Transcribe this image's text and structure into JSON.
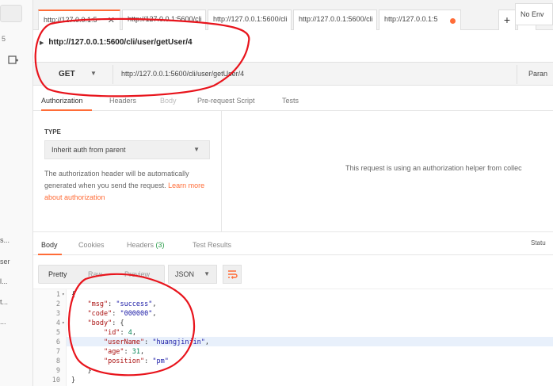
{
  "sidebar": {
    "count": "5",
    "items": [
      "s...",
      "ser",
      "l...",
      "t...",
      "..."
    ]
  },
  "tabs": [
    {
      "label": "http://127.0.0.1:5",
      "close": "✕"
    },
    {
      "label": "http://127.0.0.1:5600/cli"
    },
    {
      "label": "http://127.0.0.1:5600/cli"
    },
    {
      "label": "http://127.0.0.1:5600/cli"
    },
    {
      "label": "http://127.0.0.1:5"
    }
  ],
  "tab_add": "+",
  "tab_more": "•••",
  "environment": "No Env",
  "request": {
    "name": "http://127.0.0.1:5600/cli/user/getUser/4",
    "method": "GET",
    "url": "http://127.0.0.1:5600/cli/user/getUser/4",
    "params_label": "Paran"
  },
  "request_tabs": [
    "Authorization",
    "Headers",
    "Body",
    "Pre-request Script",
    "Tests"
  ],
  "auth": {
    "type_label": "TYPE",
    "type_value": "Inherit auth from parent",
    "description": "The authorization header will be automatically generated when you send the request.",
    "learn_more": "Learn more about authorization",
    "helper_text": "This request is using an authorization helper from collec"
  },
  "response_tabs": {
    "body": "Body",
    "cookies": "Cookies",
    "headers": "Headers",
    "headers_count": "(3)",
    "test_results": "Test Results"
  },
  "status_label": "Statu",
  "format": {
    "pretty": "Pretty",
    "raw": "Raw",
    "preview": "Preview",
    "type": "JSON"
  },
  "code_lines": [
    {
      "n": "1",
      "fold": "▾",
      "html_key": "l1"
    },
    {
      "n": "2"
    },
    {
      "n": "3"
    },
    {
      "n": "4",
      "fold": "▾"
    },
    {
      "n": "5"
    },
    {
      "n": "6"
    },
    {
      "n": "7"
    },
    {
      "n": "8"
    },
    {
      "n": "9"
    },
    {
      "n": "10"
    }
  ],
  "code": {
    "l1": "{",
    "l2_key": "\"msg\"",
    "l2_val": "\"success\"",
    "l3_key": "\"code\"",
    "l3_val": "\"000000\"",
    "l4_key": "\"body\"",
    "l4_rest": ": {",
    "l5_key": "\"id\"",
    "l5_val": "4",
    "l6_key": "\"userName\"",
    "l6_val": "\"huangjinjin\"",
    "l7_key": "\"age\"",
    "l7_val": "31",
    "l8_key": "\"position\"",
    "l8_val": "\"pm\"",
    "l9": "}",
    "l10": "}"
  },
  "colors": {
    "accent": "#ff6c37",
    "annotation": "#e8141c",
    "count_green": "#2a9c4a"
  }
}
